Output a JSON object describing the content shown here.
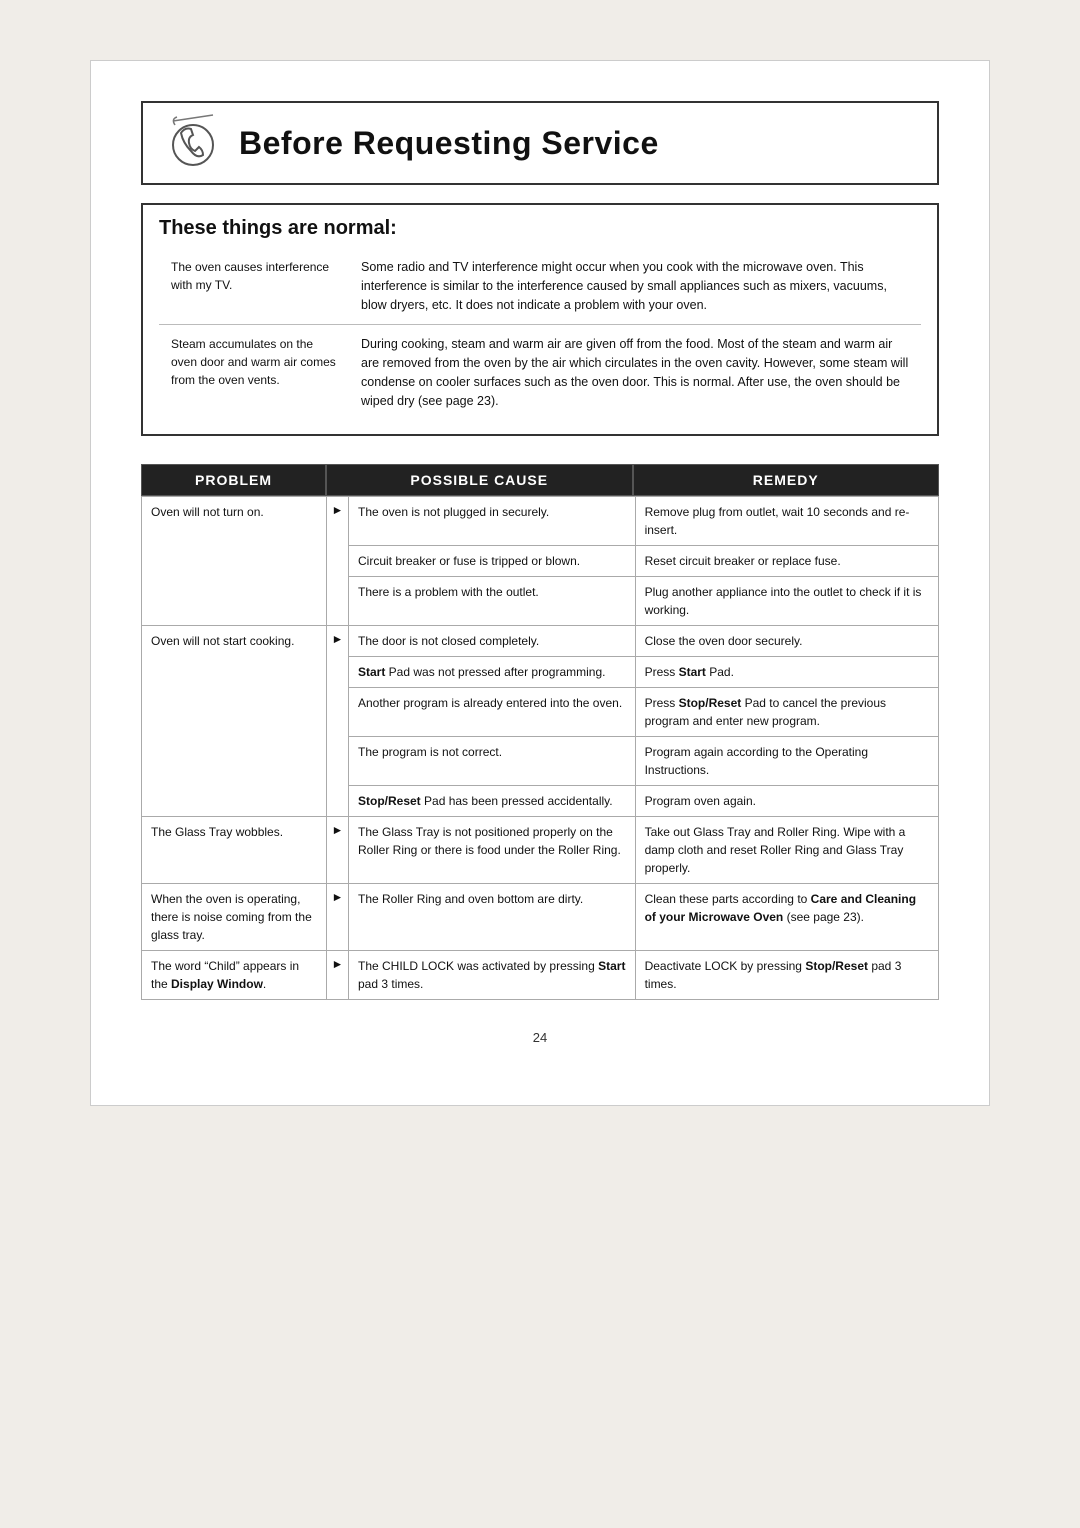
{
  "title": "Before Requesting Service",
  "normal_section": {
    "heading": "These things are normal:",
    "rows": [
      {
        "problem": "The oven causes interference with my TV.",
        "explanation": "Some radio and TV interference might occur when you cook with the microwave oven. This interference is similar to the interference caused by small appliances such as mixers, vacuums, blow dryers, etc. It does not indicate a problem with your oven."
      },
      {
        "problem": "Steam accumulates on the oven door and warm air comes from the oven vents.",
        "explanation": "During cooking, steam and warm air are given off from the food. Most of the steam and warm air are removed from the oven by the air which circulates in the oven cavity. However, some steam will condense on cooler surfaces such as the oven door. This is normal. After use, the oven should be wiped dry (see page 23)."
      }
    ]
  },
  "headers": {
    "problem": "PROBLEM",
    "cause": "POSSIBLE CAUSE",
    "remedy": "REMEDY"
  },
  "problems": [
    {
      "problem": "Oven will not turn on.",
      "causes": [
        {
          "cause": "The oven is not plugged in securely.",
          "remedy": "Remove plug from outlet, wait 10 seconds and re-insert."
        },
        {
          "cause": "Circuit breaker or fuse is tripped or blown.",
          "remedy": "Reset circuit breaker or replace fuse."
        },
        {
          "cause": "There is a problem with the outlet.",
          "remedy": "Plug another appliance into the outlet to check if it is working."
        }
      ]
    },
    {
      "problem": "Oven will not start cooking.",
      "causes": [
        {
          "cause": "The door is not closed completely.",
          "remedy": "Close the oven door securely."
        },
        {
          "cause_html": "<b>Start</b> Pad was not pressed after programming.",
          "remedy_html": "Press <b>Start</b> Pad."
        },
        {
          "cause": "Another program is already entered into the oven.",
          "remedy_html": "Press <b>Stop/Reset</b> Pad to cancel the previous program and enter new program."
        },
        {
          "cause": "The program is not correct.",
          "remedy": "Program again according to the Operating Instructions."
        },
        {
          "cause_html": "<b>Stop/Reset</b> Pad has been pressed accidentally.",
          "remedy": "Program oven again."
        }
      ]
    },
    {
      "problem": "The Glass Tray wobbles.",
      "causes": [
        {
          "cause": "The Glass Tray is not positioned properly on the Roller Ring or there is food under the Roller Ring.",
          "remedy": "Take out Glass Tray and Roller Ring. Wipe with a damp cloth and reset Roller Ring and Glass Tray properly."
        }
      ]
    },
    {
      "problem": "When the oven is operating, there is noise coming from the glass tray.",
      "causes": [
        {
          "cause": "The Roller Ring and oven bottom are dirty.",
          "remedy_html": "Clean these parts according to <b>Care and Cleaning of your Microwave Oven</b> (see page 23)."
        }
      ]
    },
    {
      "problem_html": "The word “Child” appears in the <b>Display Window</b>.",
      "causes": [
        {
          "cause_html": "The CHILD LOCK was activated by pressing <b>Start</b> pad 3 times.",
          "remedy_html": "Deactivate LOCK by pressing <b>Stop/Reset</b> pad 3 times."
        }
      ]
    }
  ],
  "page_number": "24"
}
